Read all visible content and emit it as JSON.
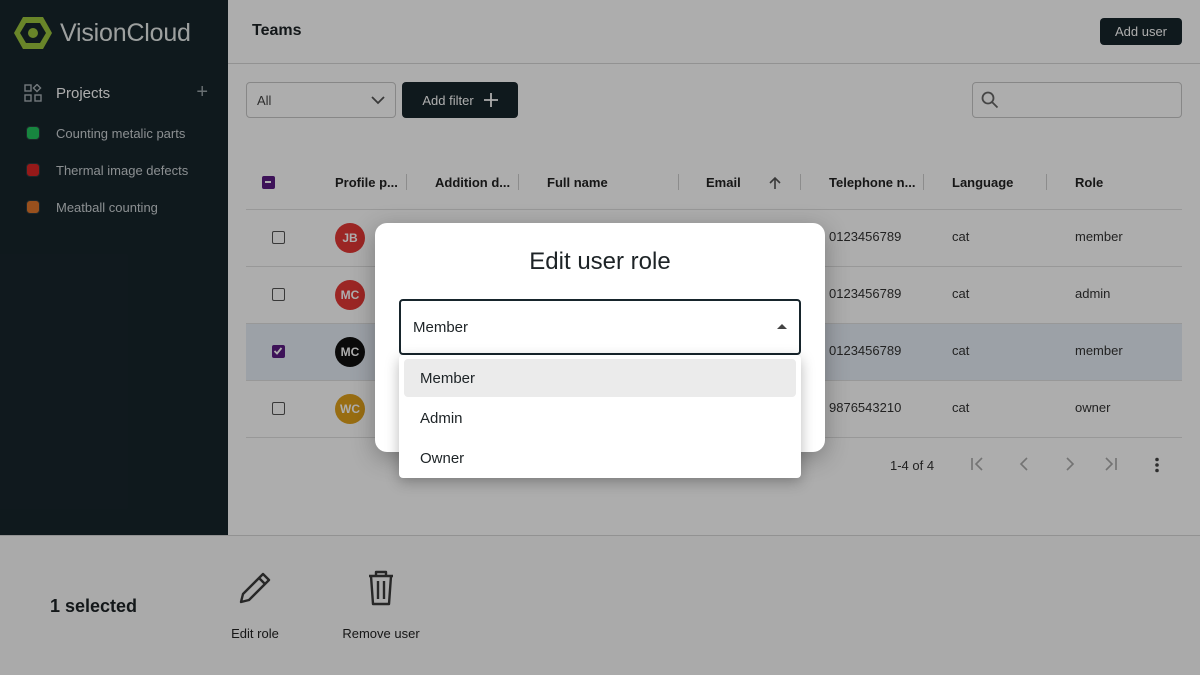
{
  "app": {
    "name": "VisionCloud"
  },
  "sidebar": {
    "projects_label": "Projects",
    "items": [
      {
        "label": "Counting metalic parts",
        "color": "#22c55e"
      },
      {
        "label": "Thermal image defects",
        "color": "#dc2626"
      },
      {
        "label": "Meatball counting",
        "color": "#e0772b"
      }
    ]
  },
  "header": {
    "title": "Teams",
    "add_user_label": "Add user"
  },
  "filters": {
    "select_value": "All",
    "add_filter_label": "Add filter",
    "search_placeholder": ""
  },
  "table": {
    "columns": [
      "Profile p...",
      "Addition d...",
      "Full name",
      "Email",
      "Telephone n...",
      "Language",
      "Role"
    ],
    "rows": [
      {
        "initials": "JB",
        "avatar_color": "#e53935",
        "checked": false,
        "phone": "0123456789",
        "language": "cat",
        "role": "member"
      },
      {
        "initials": "MC",
        "avatar_color": "#e53935",
        "checked": false,
        "phone": "0123456789",
        "language": "cat",
        "role": "admin"
      },
      {
        "initials": "MC",
        "avatar_color": "#111111",
        "checked": true,
        "phone": "0123456789",
        "language": "cat",
        "role": "member"
      },
      {
        "initials": "WC",
        "avatar_color": "#e0a11b",
        "checked": false,
        "phone": "9876543210",
        "language": "cat",
        "role": "owner"
      }
    ]
  },
  "pagination": {
    "range_text": "1-4 of 4"
  },
  "bottom_bar": {
    "selected_text": "1 selected",
    "edit_role_label": "Edit role",
    "remove_user_label": "Remove user"
  },
  "modal": {
    "title": "Edit user role",
    "selected_value": "Member",
    "options": [
      "Member",
      "Admin",
      "Owner"
    ]
  },
  "colors": {
    "sidebar_bg": "#17252c",
    "accent": "#5a1b82",
    "logo_green": "#9bc53d"
  }
}
